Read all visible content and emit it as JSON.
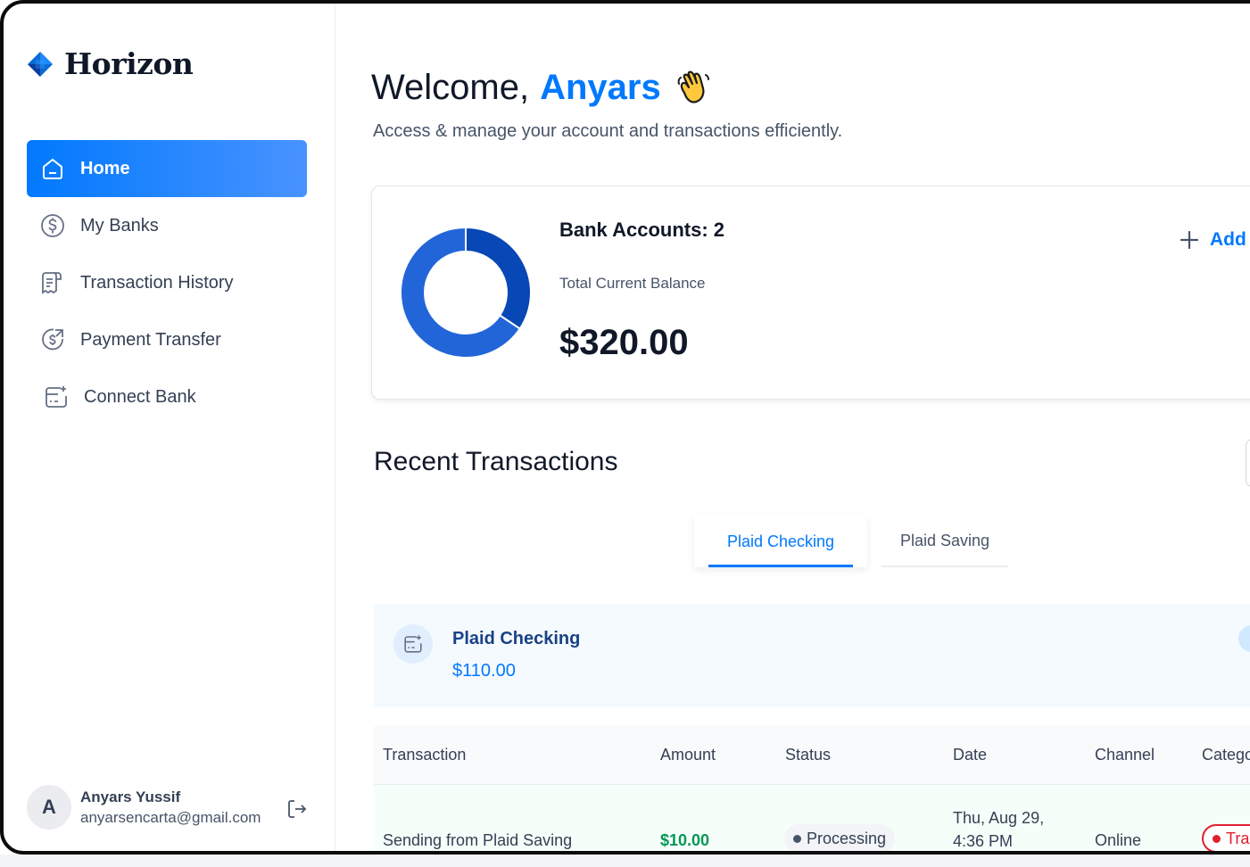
{
  "app": {
    "name": "Horizon"
  },
  "sidebar": {
    "items": [
      {
        "label": "Home",
        "icon": "home-icon"
      },
      {
        "label": "My Banks",
        "icon": "dollar-circle-icon"
      },
      {
        "label": "Transaction History",
        "icon": "receipt-icon"
      },
      {
        "label": "Payment Transfer",
        "icon": "money-send-icon"
      },
      {
        "label": "Connect Bank",
        "icon": "connect-bank-icon"
      }
    ],
    "active_index": 0
  },
  "user": {
    "initial": "A",
    "name": "Anyars Yussif",
    "email": "anyarsencarta@gmail.com"
  },
  "header": {
    "greeting": "Welcome,",
    "first_name": "Anyars",
    "subtitle": "Access & manage your account and transactions efficiently."
  },
  "balance": {
    "accounts_label": "Bank Accounts: 2",
    "total_label": "Total Current Balance",
    "total_amount": "$320.00",
    "add_label": "Add",
    "donut": [
      {
        "name": "Plaid Checking",
        "value": 110,
        "color": "#0747b6"
      },
      {
        "name": "Plaid Saving",
        "value": 210,
        "color": "#2265d8"
      }
    ]
  },
  "recent": {
    "title": "Recent Transactions",
    "tabs": [
      "Plaid Checking",
      "Plaid Saving"
    ],
    "active_tab": 0,
    "bank": {
      "name": "Plaid Checking",
      "balance": "$110.00"
    },
    "columns": [
      "Transaction",
      "Amount",
      "Status",
      "Date",
      "Channel",
      "Category"
    ],
    "rows": [
      {
        "name": "Sending from Plaid Saving",
        "amount": "$10.00",
        "status": "Processing",
        "date": "Thu, Aug 29, 4:36 PM",
        "channel": "Online",
        "category": "Transfer"
      }
    ]
  },
  "colors": {
    "accent": "#0179fe",
    "success": "#039855",
    "danger": "#e11d2e"
  }
}
